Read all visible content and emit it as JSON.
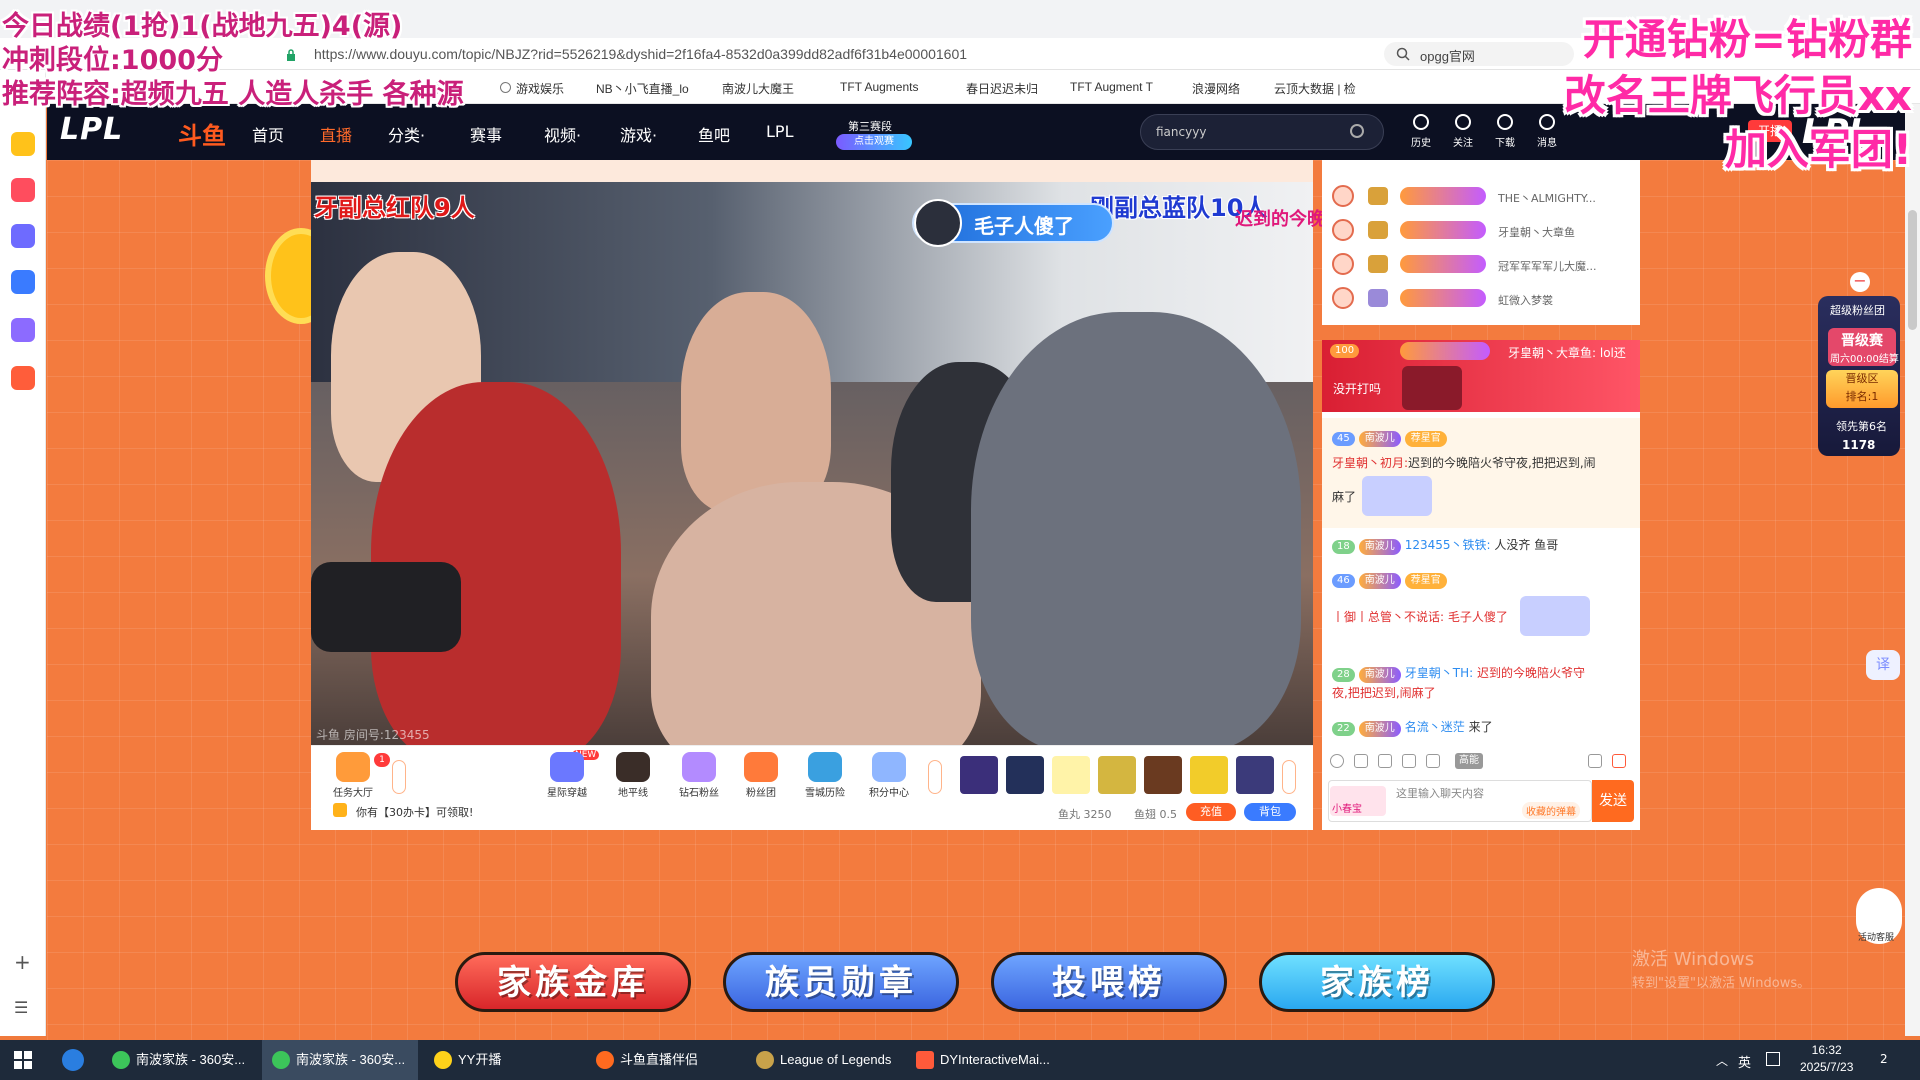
{
  "overlay_left": {
    "line1": "今日战绩(1抢)1(战地九五)4(源)",
    "line2": "冲刺段位:1000分",
    "line3": "推荐阵容:超频九五 人造人杀手 各种源"
  },
  "overlay_right": {
    "line1": "开通钻粉=钻粉群",
    "line2": "改名王牌飞行员xx",
    "line3": "加入军团!"
  },
  "browser": {
    "url": "https://www.douyu.com/topic/NBJZ?rid=5526219&dyshid=2f16fa4-8532d0a399dd82adf6f31b4e00001601",
    "search_value": "opgg官网",
    "bookmarks": [
      "新闻",
      "游戏娱乐",
      "NB丶小飞直播_lo",
      "南波儿大魔王",
      "TFT Augments",
      "春日迟迟未归",
      "TFT Augment T",
      "浪漫网络",
      "云顶大数据 | 检"
    ]
  },
  "site_nav": {
    "logo": "LPL",
    "logo2": "斗鱼",
    "items": [
      "首页",
      "直播",
      "分类·",
      "赛事",
      "视频·",
      "游戏·",
      "鱼吧",
      "LPL"
    ],
    "badge_line1": "第三赛段",
    "badge_line2": "点击观赛",
    "search_value": "fiancyyy",
    "tools": [
      "历史",
      "关注",
      "下载",
      "消息"
    ],
    "broadcast": "开播",
    "right_logo": "LPL"
  },
  "video": {
    "label_red": "牙副总红队9人",
    "label_blue": "刚副总蓝队10人",
    "label_sub": "迟到的今晚",
    "bubble": "毛子人傻了",
    "watermark": "斗鱼 房间号:123455"
  },
  "gift_bar": {
    "task_label": "任务大厅",
    "task_count": "1",
    "new_tag": "NEW",
    "tabs": [
      "星际穿越",
      "地平线",
      "钻石粉丝",
      "粉丝团",
      "雪城历险",
      "积分中心"
    ],
    "tip": "你有【30办卡】可领取!",
    "fish_balls": "鱼丸 3250",
    "fish_wings": "鱼翅 0.5",
    "recharge": "充值",
    "bag": "背包"
  },
  "rank_list": [
    {
      "badge": "南波儿",
      "name": "THE丶ALMIGHTY..."
    },
    {
      "badge": "南波儿",
      "name": "牙皇朝丶大章鱼"
    },
    {
      "badge": "南波儿",
      "name": "冠军军军军儿大魔..."
    },
    {
      "badge": "南波儿",
      "name": "虹微入梦裳"
    }
  ],
  "gift_banner": {
    "level": "100",
    "badge": "南波儿",
    "text": "牙皇朝丶大章鱼: lol还",
    "text2": "没开打吗"
  },
  "chat": [
    {
      "level": "45",
      "badge": "南波儿",
      "role": "荐星官",
      "nick": "牙皇朝丶初月:",
      "msg": "迟到的今晚陪火爷守夜,把把迟到,闹",
      "msg2": "麻了"
    },
    {
      "level": "18",
      "badge": "南波儿",
      "nick": "123455丶铁铁:",
      "msg": "人没齐 鱼哥"
    },
    {
      "level": "46",
      "badge": "南波儿",
      "role": "荐星官",
      "nick": "丨御丨总管丶不说话:",
      "msg": "毛子人傻了"
    },
    {
      "level": "28",
      "badge": "南波儿",
      "nick": "牙皇朝丶TH:",
      "msg": "迟到的今晚陪火爷守",
      "msg2": "夜,把把迟到,闹麻了"
    },
    {
      "level": "22",
      "badge": "南波儿",
      "nick": "名流丶迷茫",
      "msg": "来了"
    }
  ],
  "chat_tools": {
    "gaoneng": "高能"
  },
  "chat_input": {
    "placeholder": "这里输入聊天内容",
    "collect": "收藏的弹幕",
    "send": "发送",
    "mini_label": "小春宝"
  },
  "side_widget": {
    "title": "超级粉丝团",
    "stage": "晋级赛",
    "countdown": "周六00:00结算",
    "zone": "晋级区",
    "rank_label": "排名:1",
    "lead": "领先第6名",
    "points": "1178",
    "translate": "译",
    "kefu": "活动客服"
  },
  "family_buttons": [
    "家族金库",
    "族员勋章",
    "投喂榜",
    "家族榜"
  ],
  "windows_activation": {
    "line1": "激活 Windows",
    "line2": "转到\"设置\"以激活 Windows。"
  },
  "taskbar": {
    "items": [
      "南波家族 - 360安...",
      "南波家族 - 360安...",
      "YY开播",
      "斗鱼直播伴侣",
      "League of Legends",
      "DYInteractiveMai..."
    ],
    "ime": "英",
    "time": "16:32",
    "date": "2025/7/23",
    "notifications": "2"
  }
}
